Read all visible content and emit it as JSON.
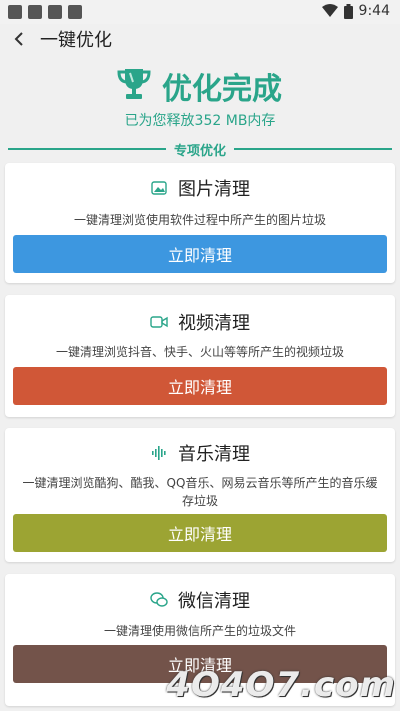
{
  "status_bar": {
    "time": "9:44"
  },
  "header": {
    "back_icon": "chevron-left-icon",
    "title": "一键优化"
  },
  "result": {
    "title": "优化完成",
    "freed_text": "已为您释放352 MB内存",
    "trophy_icon": "trophy-icon",
    "accent_color": "#2aa58a"
  },
  "section": {
    "label": "专项优化"
  },
  "cards": [
    {
      "icon": "image-icon",
      "title": "图片清理",
      "description": "一键清理浏览使用软件过程中所产生的图片垃圾",
      "button_label": "立即清理",
      "button_color": "#3d97e0"
    },
    {
      "icon": "video-icon",
      "title": "视频清理",
      "description": "一键清理浏览抖音、快手、火山等等所产生的视频垃圾",
      "button_label": "立即清理",
      "button_color": "#d05737"
    },
    {
      "icon": "audio-wave-icon",
      "title": "音乐清理",
      "description": "一键清理浏览酷狗、酷我、QQ音乐、网易云音乐等所产生的音乐缓存垃圾",
      "button_label": "立即清理",
      "button_color": "#9ca433"
    },
    {
      "icon": "wechat-icon",
      "title": "微信清理",
      "description": "一键清理使用微信所产生的垃圾文件",
      "button_label": "立即清理",
      "button_color": "#73534a"
    }
  ],
  "watermark": "4O4O7.com"
}
